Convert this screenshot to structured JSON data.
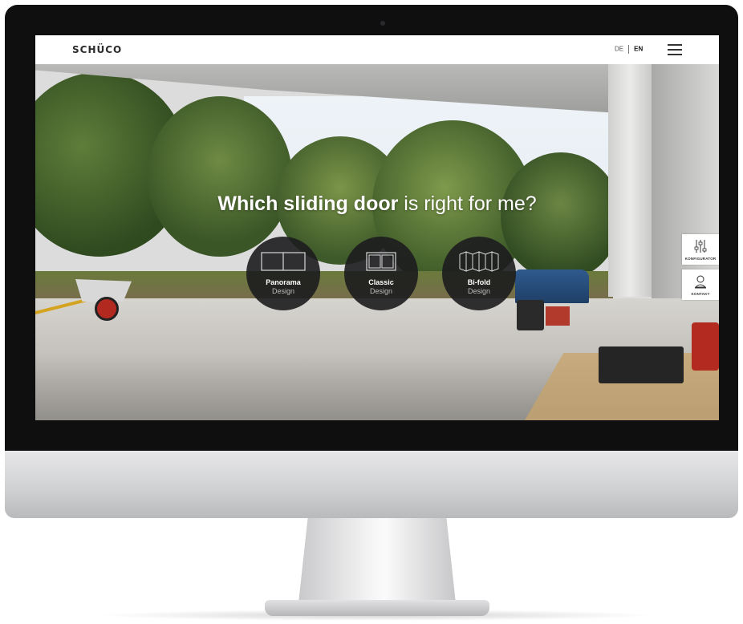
{
  "header": {
    "logo": "SCHÜCO",
    "lang_de": "DE",
    "lang_en": "EN"
  },
  "hero": {
    "title_bold": "Which sliding door",
    "title_light": "is right for me?"
  },
  "options": [
    {
      "title": "Panorama",
      "subtitle": "Design",
      "icon": "panorama-door-icon"
    },
    {
      "title": "Classic",
      "subtitle": "Design",
      "icon": "classic-door-icon"
    },
    {
      "title": "Bi-fold",
      "subtitle": "Design",
      "icon": "bifold-door-icon"
    }
  ],
  "side": {
    "configurator": "KONFIGURATOR",
    "contact": "KONTAKT"
  },
  "colors": {
    "header_bg": "#ffffff",
    "circle_bg": "#1c1c1e",
    "text_light": "#ffffff"
  }
}
